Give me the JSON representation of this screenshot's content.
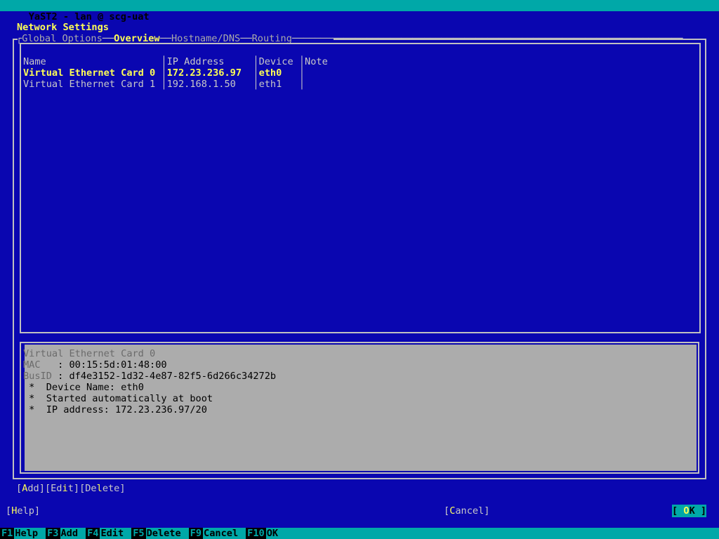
{
  "window": {
    "title": "YaST2 - lan @ scg-uat"
  },
  "page": {
    "heading": "Network Settings"
  },
  "tabs": {
    "corner": "┌",
    "separator": "──",
    "trailing": "────────────────────────────────────────────────────────────────────",
    "items": [
      {
        "label": "Global Options",
        "selected": false
      },
      {
        "label": "Overview",
        "selected": true
      },
      {
        "label": "Hostname/DNS",
        "selected": false
      },
      {
        "label": "Routing",
        "selected": false
      }
    ]
  },
  "table": {
    "vbar": "│",
    "columns": [
      {
        "key": "name",
        "label": "Name",
        "width": 24
      },
      {
        "key": "ip",
        "label": "IP Address",
        "width": 15
      },
      {
        "key": "device",
        "label": "Device",
        "width": 7
      },
      {
        "key": "note",
        "label": "Note",
        "width": 5
      }
    ],
    "rows": [
      {
        "name": "Virtual Ethernet Card 0",
        "ip": "172.23.236.97",
        "device": "eth0",
        "note": "",
        "selected": true
      },
      {
        "name": "Virtual Ethernet Card 1",
        "ip": "192.168.1.50",
        "device": "eth1",
        "note": "",
        "selected": false
      }
    ]
  },
  "detail": {
    "device_title": "Virtual Ethernet Card 0",
    "fields": [
      {
        "label": "MAC  ",
        "sep": ": ",
        "value": "00:15:5d:01:48:00"
      },
      {
        "label": "BusID",
        "sep": ": ",
        "value": "df4e3152-1d32-4e87-82f5-6d266c34272b"
      }
    ],
    "bullet": "*",
    "bullets": [
      "Device Name: eth0",
      "Started automatically at boot",
      "IP address: 172.23.236.97/20"
    ]
  },
  "action_buttons": [
    {
      "pre": "[",
      "hot": "A",
      "post": "dd]"
    },
    {
      "pre": "[Ed",
      "hot": "i",
      "post": "t]"
    },
    {
      "pre": "[De",
      "hot": "l",
      "post": "ete]"
    }
  ],
  "bottom_buttons": {
    "help": {
      "pre": "[",
      "hot": "H",
      "post": "elp]"
    },
    "cancel": {
      "pre": "[",
      "hot": "C",
      "post": "ancel]"
    },
    "ok": {
      "pre": "[ ",
      "hot": "O",
      "post": "K ]"
    }
  },
  "function_keys": [
    {
      "key": "F1",
      "label": "Help"
    },
    {
      "key": "F3",
      "label": "Add"
    },
    {
      "key": "F4",
      "label": "Edit"
    },
    {
      "key": "F5",
      "label": "Delete"
    },
    {
      "key": "F9",
      "label": "Cancel"
    },
    {
      "key": "F10",
      "label": "OK"
    }
  ],
  "colors": {
    "background": "#0a06b0",
    "accent_teal": "#00a8a8",
    "selected_text": "#ffff55",
    "normal_text": "#c8c8c8",
    "frame": "#c0c0c0",
    "detail_panel": "#acacac"
  }
}
